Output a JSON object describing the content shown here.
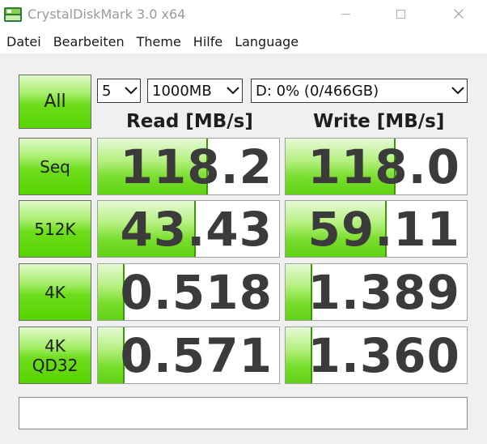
{
  "window": {
    "title": "CrystalDiskMark 3.0 x64"
  },
  "menu": {
    "items": [
      "Datei",
      "Bearbeiten",
      "Theme",
      "Hilfe",
      "Language"
    ]
  },
  "controls": {
    "count": "5",
    "size": "1000MB",
    "drive": "D: 0% (0/466GB)"
  },
  "headers": {
    "read": "Read [MB/s]",
    "write": "Write [MB/s]"
  },
  "buttons": {
    "all": "All"
  },
  "tests": [
    {
      "label": "Seq",
      "read": "118.2",
      "write": "118.0",
      "read_fill": 0.6,
      "write_fill": 0.6
    },
    {
      "label": "512K",
      "read": "43.43",
      "write": "59.11",
      "read_fill": 0.53,
      "write_fill": 0.55
    },
    {
      "label": "4K",
      "read": "0.518",
      "write": "1.389",
      "read_fill": 0.14,
      "write_fill": 0.14
    },
    {
      "label": "4K\nQD32",
      "read": "0.571",
      "write": "1.360",
      "read_fill": 0.14,
      "write_fill": 0.14
    }
  ],
  "comment": "",
  "icons": {
    "app": "crystaldiskmark-icon",
    "minimize": "minimize-icon",
    "maximize": "maximize-icon",
    "close": "close-icon",
    "dropdown": "chevron-down-icon"
  },
  "colors": {
    "accent_green": "#56d300",
    "value_text": "#3b3b3b"
  }
}
